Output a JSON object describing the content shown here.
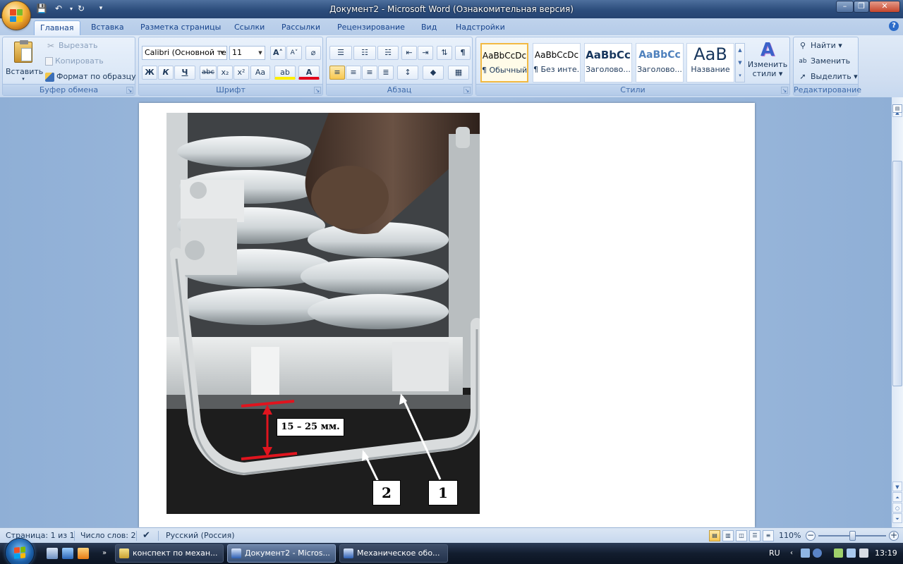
{
  "window": {
    "title": "Документ2 - Microsoft Word (Ознакомительная версия)",
    "minimize": "–",
    "maximize": "❐",
    "close": "✕"
  },
  "qat": {
    "save": "💾",
    "undo": "↶",
    "redo": "↻",
    "more": "▾"
  },
  "tabs": [
    "Главная",
    "Вставка",
    "Разметка страницы",
    "Ссылки",
    "Рассылки",
    "Рецензирование",
    "Вид",
    "Надстройки"
  ],
  "help": "?",
  "groups": {
    "clipboard": {
      "label": "Буфер обмена",
      "paste": "Вставить",
      "cut": "Вырезать",
      "copy": "Копировать",
      "format_painter": "Формат по образцу"
    },
    "font": {
      "label": "Шрифт",
      "font_name": "Calibri (Основной текст)",
      "font_size": "11",
      "grow": "A˄",
      "shrink": "A˅",
      "clear": "⌀",
      "bold": "Ж",
      "italic": "К",
      "underline": "Ч",
      "strike": "abc",
      "subscript": "x₂",
      "superscript": "x²",
      "case": "Aa",
      "highlight": "ab",
      "color": "A"
    },
    "paragraph": {
      "label": "Абзац",
      "sort": "⇅",
      "pilcrow": "¶"
    },
    "styles": {
      "label": "Стили",
      "cards": [
        {
          "sample": "AaBbCcDc",
          "name": "¶ Обычный",
          "selected": true
        },
        {
          "sample": "AaBbCcDc",
          "name": "¶ Без инте...",
          "selected": false
        },
        {
          "sample": "AaBbCc",
          "name": "Заголово...",
          "selected": false
        },
        {
          "sample": "AaBbCc",
          "name": "Заголово...",
          "selected": false
        },
        {
          "sample": "AaB",
          "name": "Название",
          "selected": false
        }
      ],
      "change_styles_line1": "Изменить",
      "change_styles_line2": "стили"
    },
    "editing": {
      "label": "Редактирование",
      "find": "Найти",
      "replace": "Заменить",
      "select": "Выделить"
    }
  },
  "document": {
    "callout_measure": "15 – 25 мм.",
    "callout_2": "2",
    "callout_1": "1"
  },
  "status": {
    "page": "Страница: 1 из 1",
    "words": "Число слов: 2",
    "language": "Русский (Россия)",
    "zoom": "110%"
  },
  "taskbar": {
    "items": [
      {
        "label": "конспект по механ...",
        "active": false
      },
      {
        "label": "Документ2 - Micros...",
        "active": true
      },
      {
        "label": "Механическое обо...",
        "active": false
      }
    ],
    "lang": "RU",
    "clock": "13:19"
  },
  "colors": {
    "accent": "#15428b",
    "highlight": "#ffef00",
    "font_color": "#e3001b",
    "marker_red": "#e0141e"
  }
}
